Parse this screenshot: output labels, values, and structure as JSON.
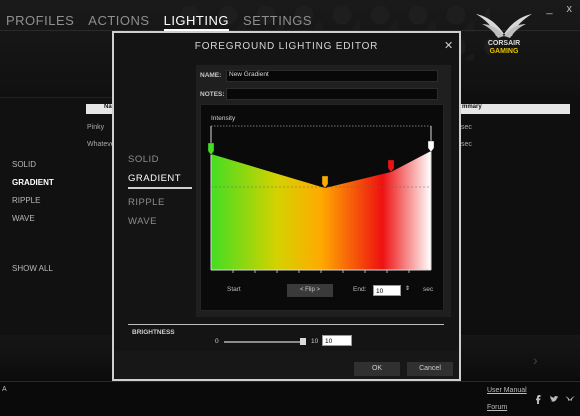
{
  "nav": {
    "tabs": [
      {
        "label": "PROFILES",
        "active": false
      },
      {
        "label": "ACTIONS",
        "active": false
      },
      {
        "label": "LIGHTING",
        "active": true
      },
      {
        "label": "SETTINGS",
        "active": false
      }
    ]
  },
  "window": {
    "minimize": "_",
    "close": "x"
  },
  "logo": {
    "brand": "CORSAIR",
    "sub": "GAMING"
  },
  "background": {
    "left_list": [
      "SOLID",
      "GRADIENT",
      "RIPPLE",
      "WAVE"
    ],
    "left_active": "GRADIENT",
    "show_all": "SHOW ALL",
    "table_header": "Na",
    "rows": [
      "Pinky",
      "Whateve"
    ],
    "right_header": "mmary",
    "right_cells": [
      "sec",
      "sec"
    ]
  },
  "footer": {
    "glyph": "A",
    "user_manual": "User Manual",
    "forum": "Forum"
  },
  "modal": {
    "title": "FOREGROUND LIGHTING EDITOR",
    "close": "✕",
    "types": [
      {
        "label": "SOLID",
        "active": false
      },
      {
        "label": "GRADIENT",
        "active": true
      },
      {
        "label": "RIPPLE",
        "active": false
      },
      {
        "label": "WAVE",
        "active": false
      }
    ],
    "name_label": "NAME:",
    "name_value": "New Gradient",
    "notes_label": "NOTES:",
    "notes_value": "",
    "intensity_label": "Intensity",
    "start_label": "Start",
    "flip_label": "< Flip >",
    "end_label": "End:",
    "end_value": "10",
    "end_unit": "sec",
    "brightness_label": "BRIGHTNESS",
    "brightness_min": "0",
    "brightness_max": "10",
    "brightness_value": "10",
    "ok": "OK",
    "cancel": "Cancel"
  },
  "colors": {
    "stop_start": "#44dd22",
    "stop_mid": "#ffaa00",
    "stop_red": "#ee1111",
    "stop_end": "#ffffff"
  }
}
